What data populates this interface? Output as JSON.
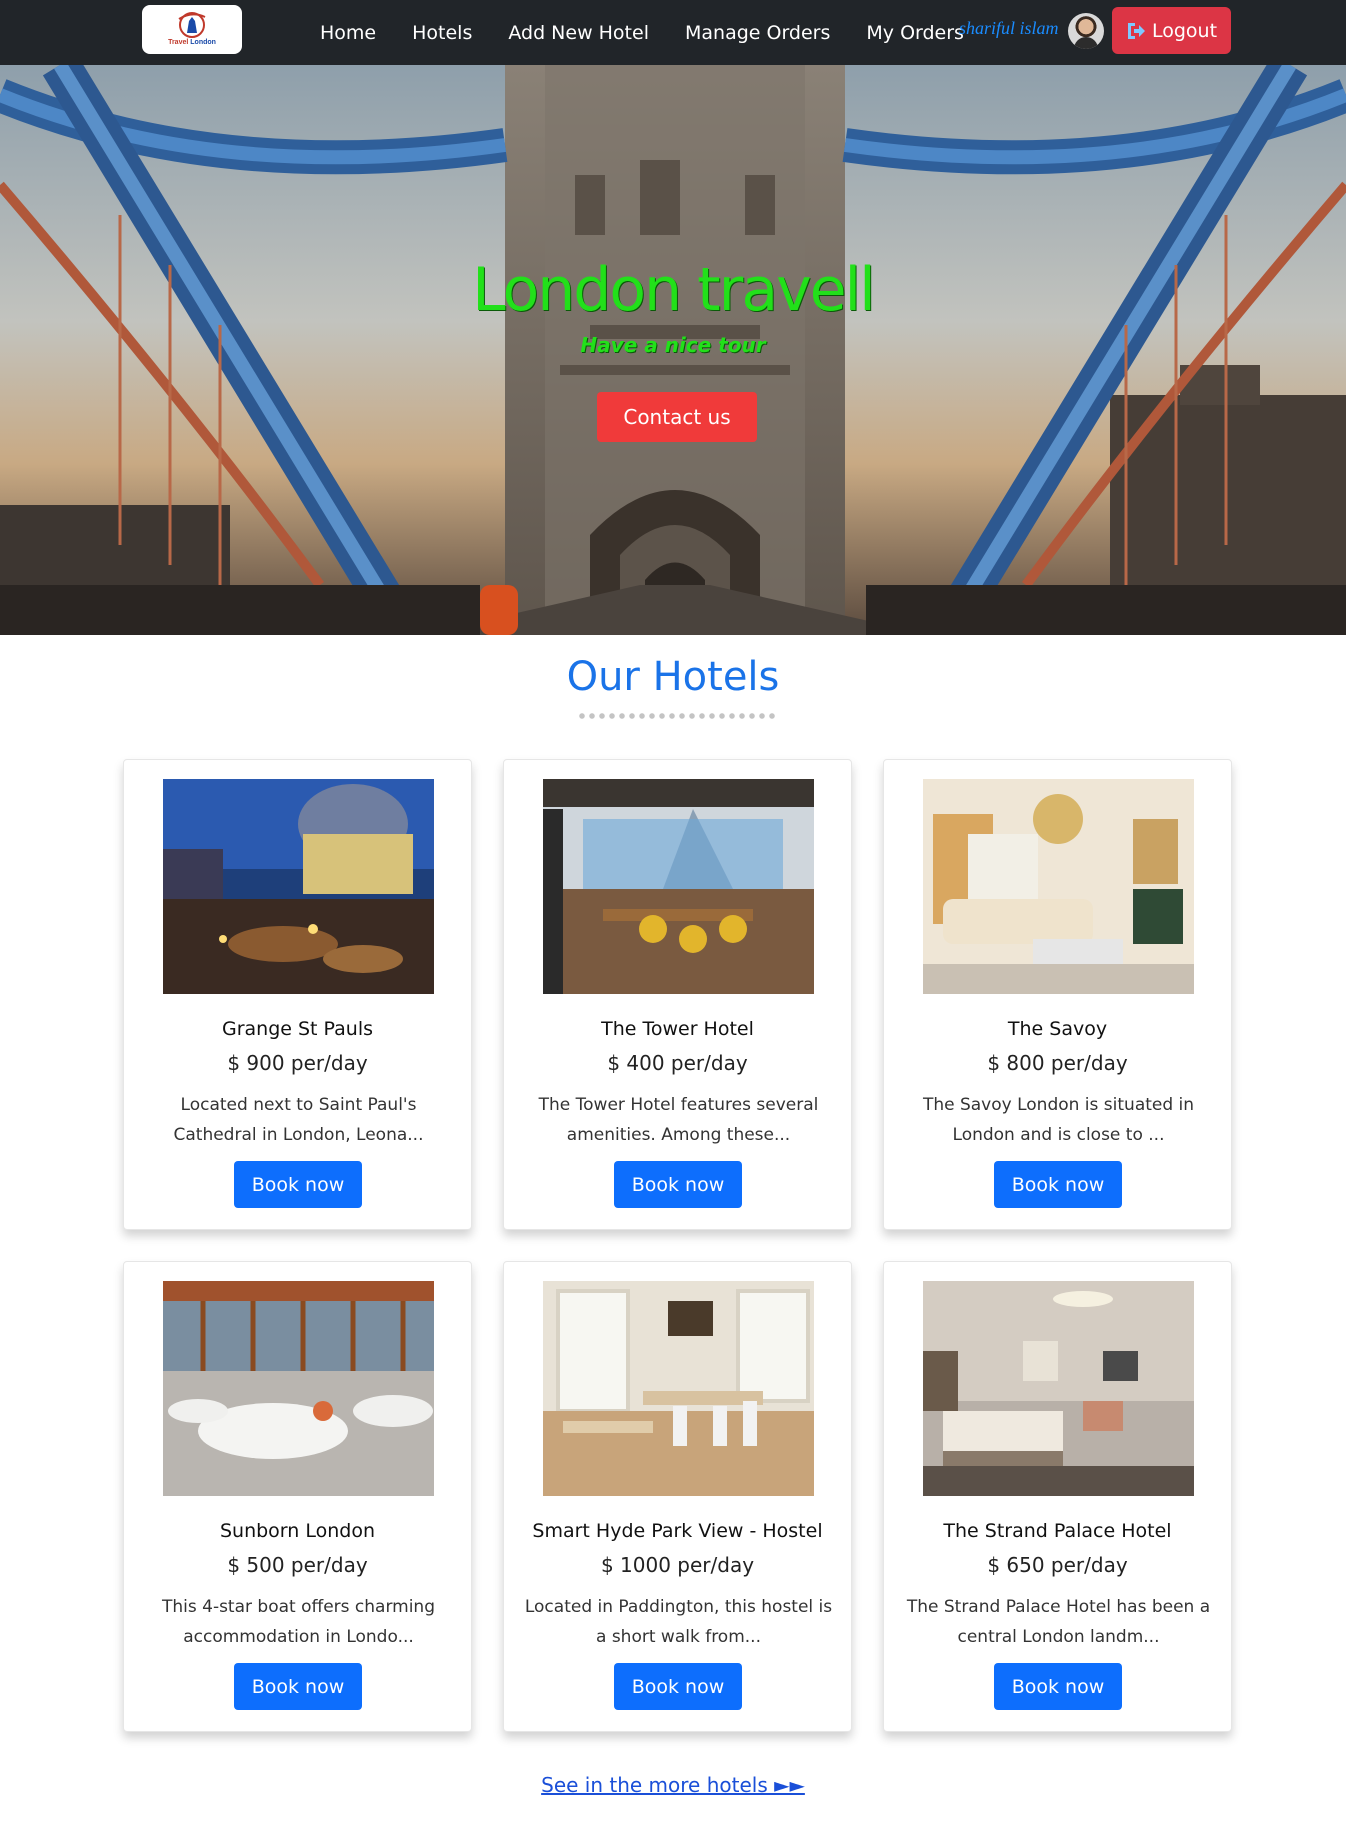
{
  "nav": {
    "logo_text_1": "Travel",
    "logo_text_2": "London",
    "links": [
      "Home",
      "Hotels",
      "Add New Hotel",
      "Manage Orders",
      "My Orders"
    ],
    "user_name": "shariful islam",
    "logout_label": "Logout",
    "logout_color": "#dc3545"
  },
  "hero": {
    "title": "London travell",
    "subtitle": "Have a nice tour",
    "contact_label": "Contact us",
    "accent": "#22e01a"
  },
  "section": {
    "title": "Our Hotels"
  },
  "hotels": [
    {
      "name": "Grange St Pauls",
      "price": "$ 900 per/day",
      "desc": "Located next to Saint Paul's Cathedral in London, Leona...",
      "book": "Book now"
    },
    {
      "name": "The Tower Hotel",
      "price": "$ 400 per/day",
      "desc": "The Tower Hotel features several amenities. Among these...",
      "book": "Book now"
    },
    {
      "name": "The Savoy",
      "price": "$ 800 per/day",
      "desc": "The Savoy London is situated in London and is close to ...",
      "book": "Book now"
    },
    {
      "name": "Sunborn London",
      "price": "$ 500 per/day",
      "desc": "This 4-star boat offers charming accommodation in Londo...",
      "book": "Book now"
    },
    {
      "name": "Smart Hyde Park View - Hostel",
      "price": "$ 1000 per/day",
      "desc": "Located in Paddington, this hostel is a short walk from...",
      "book": "Book now"
    },
    {
      "name": "The Strand Palace Hotel",
      "price": "$ 650 per/day",
      "desc": "The Strand Palace Hotel has been a central London landm...",
      "book": "Book now"
    }
  ],
  "more_link": "See in the more hotels ►►",
  "colors": {
    "primary": "#0d6efd",
    "heading": "#1a73e8",
    "navbar": "#212529"
  }
}
